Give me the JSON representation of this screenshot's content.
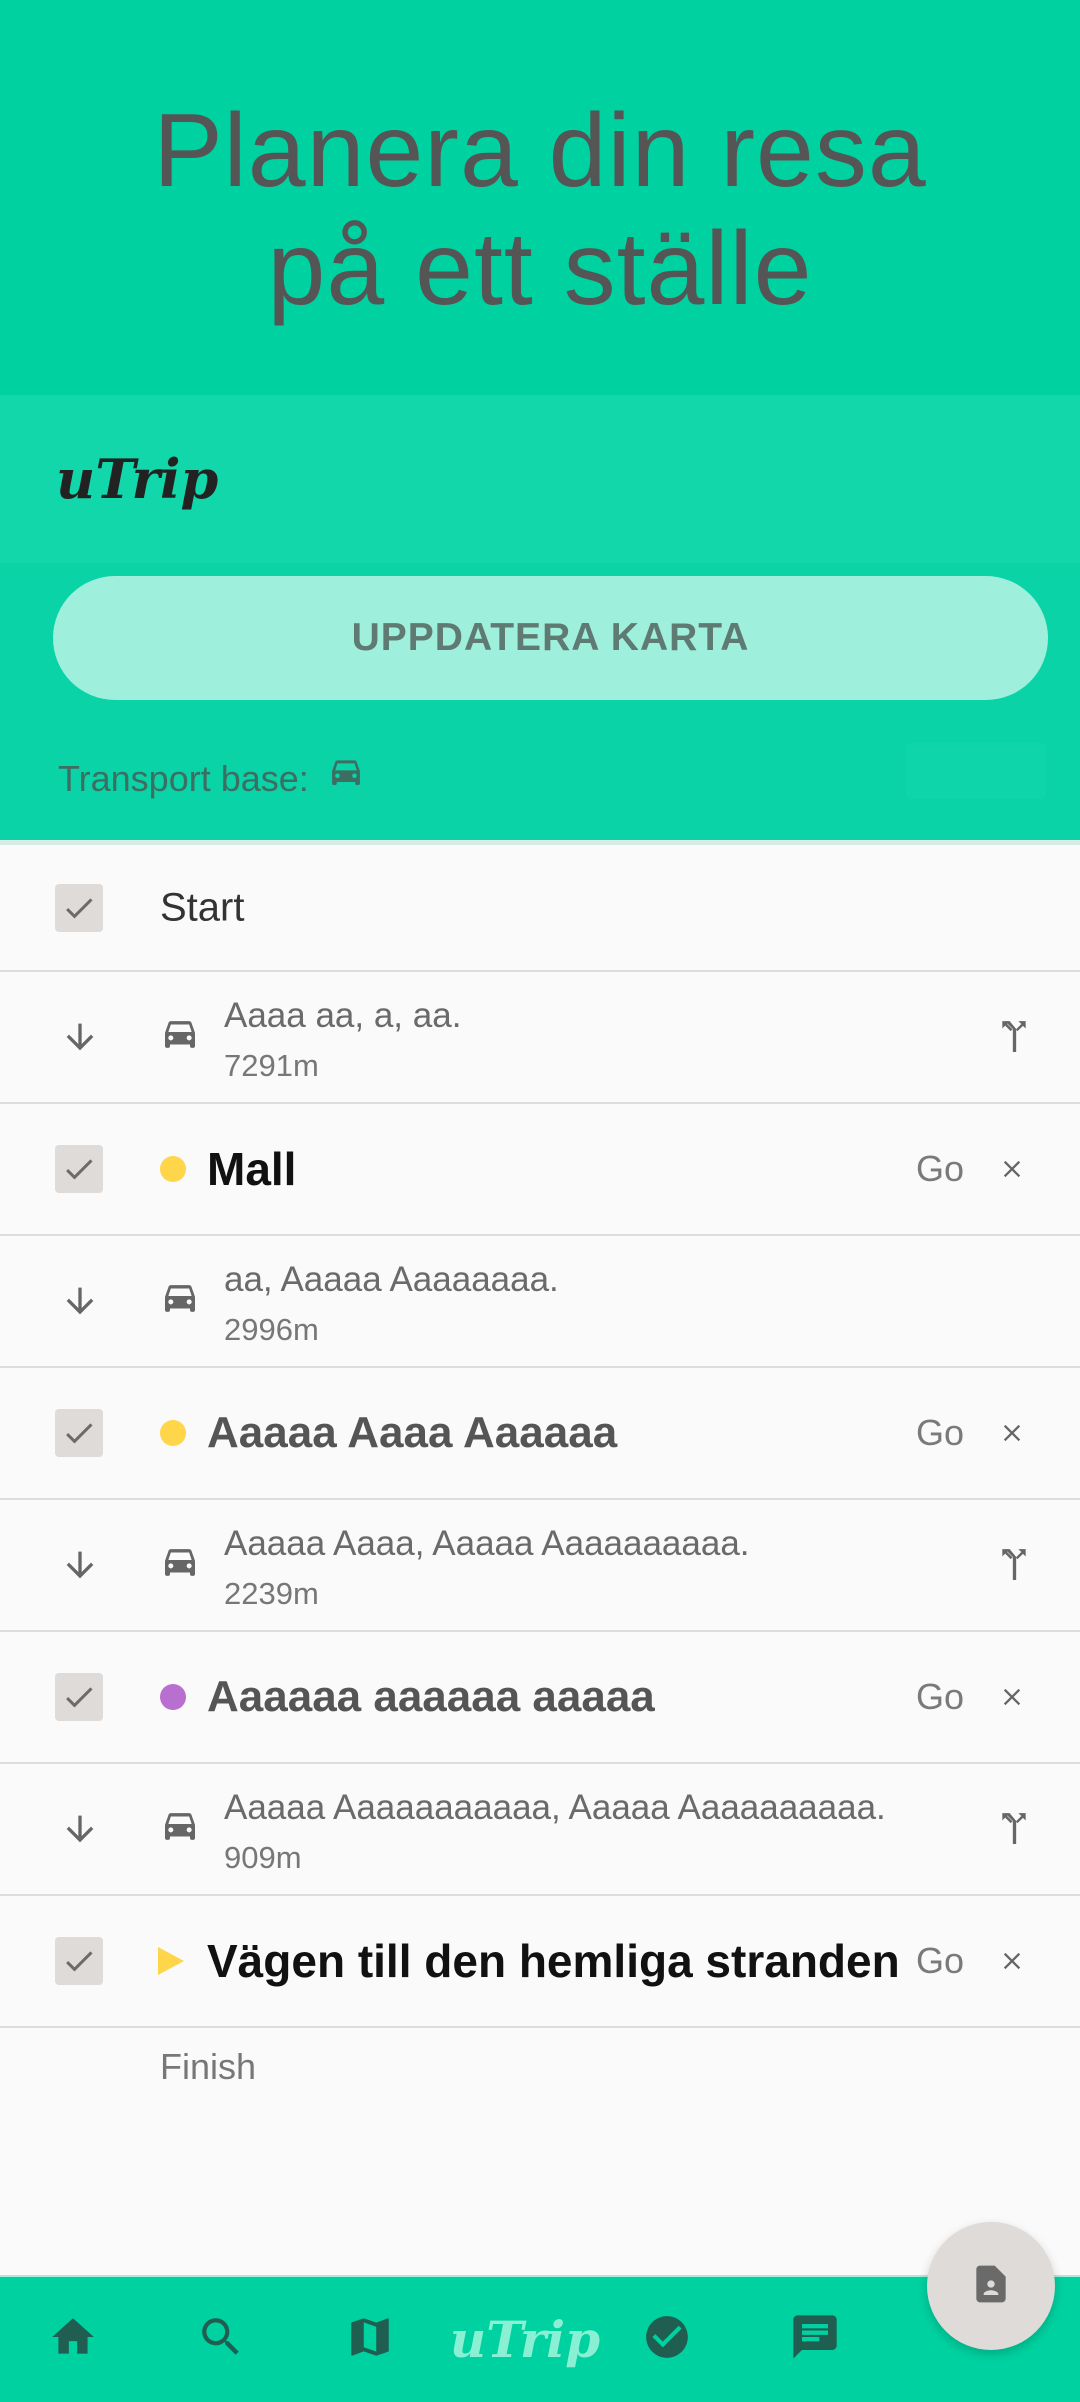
{
  "hero": {
    "line1": "Planera din resa",
    "line2": "på ett ställe"
  },
  "header": {
    "logo": "uTrip",
    "update_button": "UPPDATERA KARTA",
    "transport_label": "Transport base:",
    "transport_icon": "car-icon"
  },
  "itinerary": {
    "start_label": "Start",
    "finish_label": "Finish",
    "go_label": "Go",
    "stops": [
      {
        "title": "Mall",
        "marker": "dot",
        "color": "#ffd54a"
      },
      {
        "title": "Aaaaa Aaaa Aaaaaa",
        "marker": "dot",
        "color": "#ffd54a"
      },
      {
        "title": "Aaaaaa aaaaaa aaaaa",
        "marker": "dot",
        "color": "#b86fcf"
      },
      {
        "title": "Vägen till den hemliga stranden",
        "marker": "triangle",
        "color": "#ffd54a"
      }
    ],
    "legs": [
      {
        "address": "Aaaa aa, a, aa.",
        "distance": "7291m"
      },
      {
        "address": "aa, Aaaaa Aaaaaaaa.",
        "distance": "2996m"
      },
      {
        "address": "Aaaaa Aaaa, Aaaaa Aaaaaaaaaa.",
        "distance": "2239m"
      },
      {
        "address": "Aaaaa Aaaaaaaaaaa, Aaaaa Aaaaaaaaaa.",
        "distance": "909m"
      }
    ]
  },
  "bottom_nav": {
    "logo": "uTrip",
    "items": [
      "home-icon",
      "search-icon",
      "map-icon",
      "logo",
      "check-circle-icon",
      "chat-icon"
    ]
  },
  "colors": {
    "primary": "#00d1a0",
    "button": "#9ef0dc",
    "yellow": "#ffd54a",
    "purple": "#b86fcf"
  }
}
